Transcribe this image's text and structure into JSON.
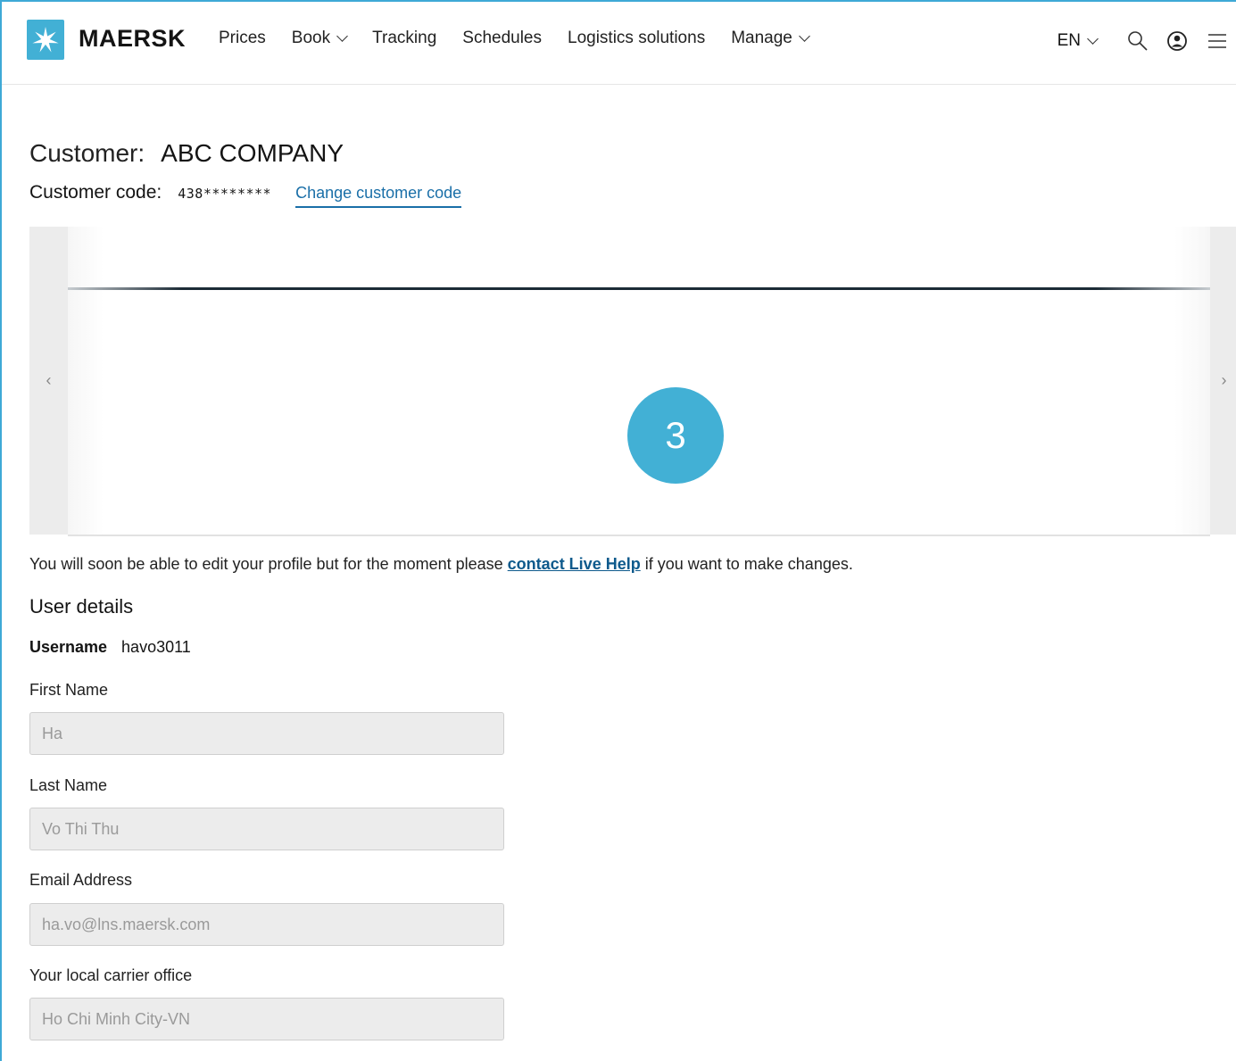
{
  "header": {
    "brand": "MAERSK",
    "nav": [
      {
        "label": "Prices",
        "dropdown": false
      },
      {
        "label": "Book",
        "dropdown": true
      },
      {
        "label": "Tracking",
        "dropdown": false
      },
      {
        "label": "Schedules",
        "dropdown": false
      },
      {
        "label": "Logistics solutions",
        "dropdown": false
      },
      {
        "label": "Manage",
        "dropdown": true
      }
    ],
    "lang": "EN",
    "icons": [
      "search-icon",
      "user-account-icon",
      "menu-icon"
    ]
  },
  "customer": {
    "label": "Customer:",
    "name": "ABC COMPANY",
    "code_label": "Customer code:",
    "code": "438********",
    "change_link": "Change customer code"
  },
  "carousel": {
    "prev": "‹",
    "next": "›",
    "step": "3"
  },
  "notice": {
    "before": "You will soon be able to edit your profile but for the moment please ",
    "link": "contact Live Help",
    "after": " if you want to make changes."
  },
  "user_details": {
    "title": "User details",
    "username_label": "Username",
    "username": "havo3011",
    "fields": [
      {
        "label": "First Name",
        "value": "Ha"
      },
      {
        "label": "Last Name",
        "value": "Vo Thi Thu"
      },
      {
        "label": "Email Address",
        "value": "ha.vo@lns.maersk.com"
      },
      {
        "label": "Your local carrier office",
        "value": "Ho Chi Minh City-VN"
      }
    ]
  },
  "colors": {
    "accent": "#42b0d5",
    "link": "#1a6fa8",
    "field_bg": "#ececec"
  }
}
